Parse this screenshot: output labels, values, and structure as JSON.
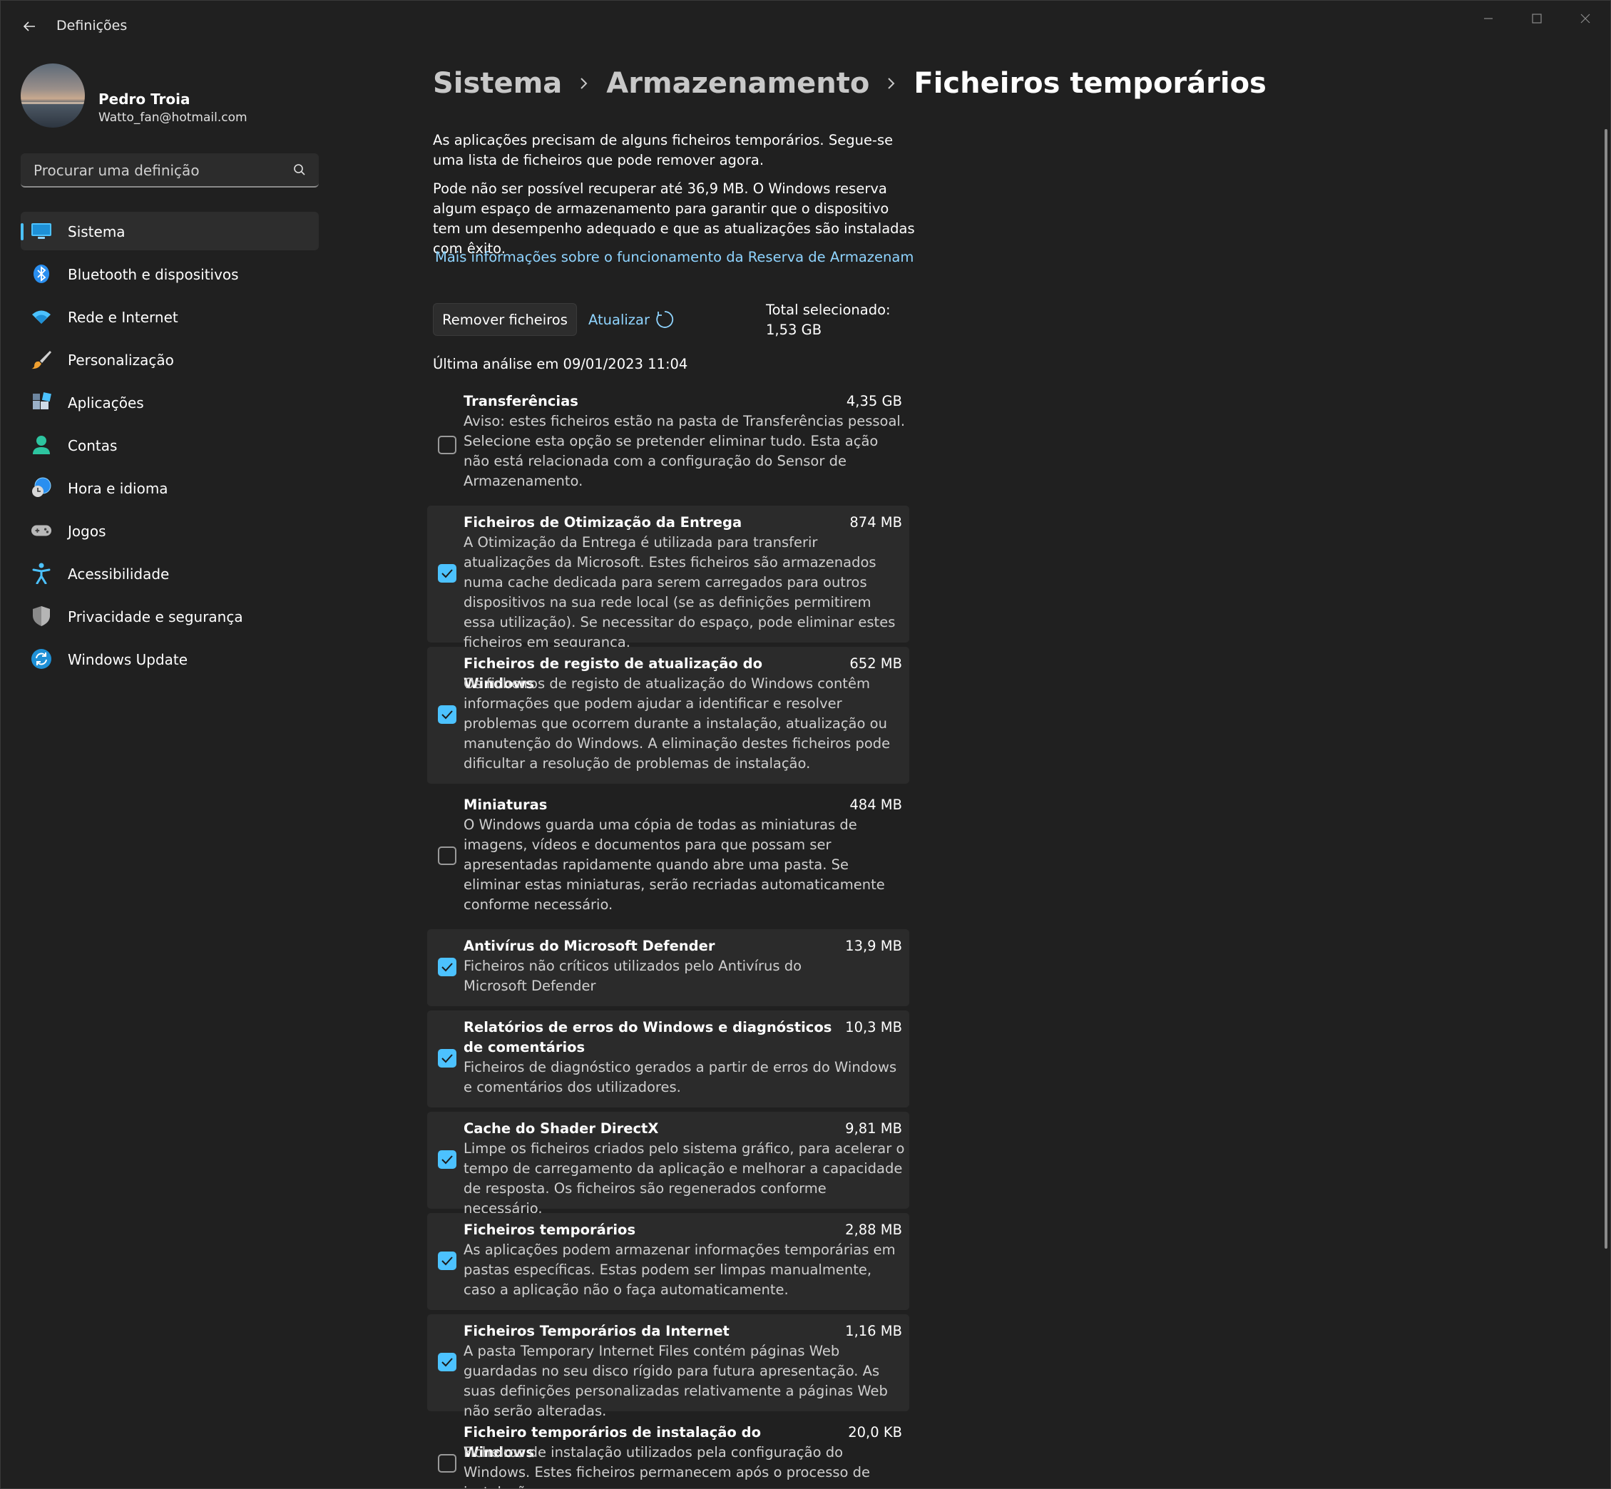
{
  "window": {
    "app_title": "Definições"
  },
  "profile": {
    "name": "Pedro Troia",
    "email": "Watto_fan@hotmail.com"
  },
  "search": {
    "placeholder": "Procurar uma definição"
  },
  "sidebar": {
    "items": [
      {
        "label": "Sistema",
        "icon": "monitor-icon",
        "active": true
      },
      {
        "label": "Bluetooth e dispositivos",
        "icon": "bluetooth-icon"
      },
      {
        "label": "Rede e Internet",
        "icon": "wifi-icon"
      },
      {
        "label": "Personalização",
        "icon": "brush-icon"
      },
      {
        "label": "Aplicações",
        "icon": "apps-icon"
      },
      {
        "label": "Contas",
        "icon": "person-icon"
      },
      {
        "label": "Hora e idioma",
        "icon": "globe-clock-icon"
      },
      {
        "label": "Jogos",
        "icon": "gamepad-icon"
      },
      {
        "label": "Acessibilidade",
        "icon": "accessibility-icon"
      },
      {
        "label": "Privacidade e segurança",
        "icon": "shield-icon"
      },
      {
        "label": "Windows Update",
        "icon": "update-icon"
      }
    ]
  },
  "breadcrumb": [
    "Sistema",
    "Armazenamento",
    "Ficheiros temporários"
  ],
  "main": {
    "intro": "As aplicações precisam de alguns ficheiros temporários. Segue-se uma lista de ficheiros que pode remover agora.",
    "reserve_note": "Pode não ser possível recuperar até 36,9 MB. O Windows reserva algum espaço de armazenamento para garantir que o dispositivo tem um desempenho adequado e que as atualizações são instaladas com êxito.",
    "more_info_link": "Mais informações sobre o funcionamento da Reserva de Armazenamento",
    "remove_button": "Remover ficheiros",
    "refresh_label": "Atualizar",
    "total_selected": "Total selecionado: 1,53 GB",
    "last_scan": "Última análise em 09/01/2023 11:04"
  },
  "items": [
    {
      "title": "Transferências",
      "size": "4,35 GB",
      "checked": false,
      "description": "Aviso: estes ficheiros estão na pasta de Transferências pessoal. Selecione esta opção se pretender eliminar tudo. Esta ação não está relacionada com a configuração do Sensor de Armazenamento."
    },
    {
      "title": "Ficheiros de Otimização da Entrega",
      "size": "874 MB",
      "checked": true,
      "description": "A Otimização da Entrega é utilizada para transferir atualizações da Microsoft. Estes ficheiros são armazenados numa cache dedicada para serem carregados para outros dispositivos na sua rede local (se as definições permitirem essa utilização). Se necessitar do espaço, pode eliminar estes ficheiros em segurança."
    },
    {
      "title": "Ficheiros de registo de atualização do Windows",
      "size": "652 MB",
      "checked": true,
      "description": "Os ficheiros de registo de atualização do Windows contêm informações que podem ajudar a identificar e resolver problemas que ocorrem durante a instalação, atualização ou manutenção do Windows. A eliminação destes ficheiros pode dificultar a resolução de problemas de instalação."
    },
    {
      "title": "Miniaturas",
      "size": "484 MB",
      "checked": false,
      "description": "O Windows guarda uma cópia de todas as miniaturas de imagens, vídeos e documentos para que possam ser apresentadas rapidamente quando abre uma pasta. Se eliminar estas miniaturas, serão recriadas automaticamente conforme necessário."
    },
    {
      "title": "Antivírus do Microsoft Defender",
      "size": "13,9 MB",
      "checked": true,
      "description": "Ficheiros não críticos utilizados pelo Antivírus do Microsoft Defender"
    },
    {
      "title": "Relatórios de erros do Windows e diagnósticos de comentários",
      "size": "10,3 MB",
      "checked": true,
      "description": "Ficheiros de diagnóstico gerados a partir de erros do Windows e comentários dos utilizadores."
    },
    {
      "title": "Cache do Shader DirectX",
      "size": "9,81 MB",
      "checked": true,
      "description": "Limpe os ficheiros criados pelo sistema gráfico, para acelerar o tempo de carregamento da aplicação e melhorar a capacidade de resposta. Os ficheiros são regenerados conforme necessário."
    },
    {
      "title": "Ficheiros temporários",
      "size": "2,88 MB",
      "checked": true,
      "description": "As aplicações podem armazenar informações temporárias em pastas específicas. Estas podem ser limpas manualmente, caso a aplicação não o faça automaticamente."
    },
    {
      "title": "Ficheiros Temporários da Internet",
      "size": "1,16 MB",
      "checked": true,
      "description": "A pasta Temporary Internet Files contém páginas Web guardadas no seu disco rígido para futura apresentação. As suas definições personalizadas relativamente a páginas Web não serão alteradas."
    },
    {
      "title": "Ficheiro temporários de instalação do Windows",
      "size": "20,0 KB",
      "checked": false,
      "description": "Ficheiros de instalação utilizados pela configuração do Windows. Estes ficheiros permanecem após o processo de instalação e"
    }
  ]
}
